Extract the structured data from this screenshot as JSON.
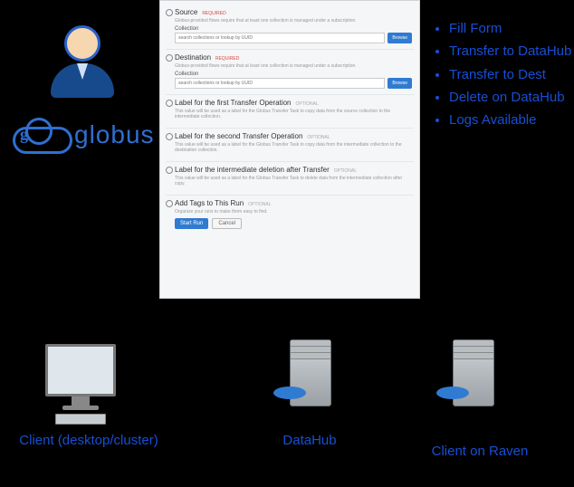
{
  "globus": {
    "logo_text": "globus",
    "logo_letter": "g"
  },
  "form": {
    "source": {
      "title": "Source",
      "required_tag": "REQUIRED",
      "desc": "Globus-provided flows require that at least one collection is managed under a subscription.",
      "collection_label": "Collection",
      "search_placeholder": "search collections or lookup by UUID",
      "browse": "Browse"
    },
    "destination": {
      "title": "Destination",
      "required_tag": "REQUIRED",
      "desc": "Globus-provided flows require that at least one collection is managed under a subscription.",
      "collection_label": "Collection",
      "search_placeholder": "search collections or lookup by UUID",
      "browse": "Browse"
    },
    "label1": {
      "title": "Label for the first Transfer Operation",
      "opt_tag": "OPTIONAL",
      "desc": "This value will be used as a label for the Globus Transfer Task to copy data from the source collection to the intermediate collection."
    },
    "label2": {
      "title": "Label for the second Transfer Operation",
      "opt_tag": "OPTIONAL",
      "desc": "This value will be used as a label for the Globus Transfer Task to copy data from the intermediate collection to the destination collection."
    },
    "label3": {
      "title": "Label for the intermediate deletion after Transfer",
      "opt_tag": "OPTIONAL",
      "desc": "This value will be used as a label for the Globus Transfer Task to delete data from the intermediate collection after copy."
    },
    "tags": {
      "title": "Add Tags to This Run",
      "opt_tag": "OPTIONAL",
      "desc": "Organize your runs to make them easy to find."
    },
    "run_btn": "Start Run",
    "cancel_btn": "Cancel"
  },
  "bullets": [
    "Fill Form",
    "Transfer to DataHub",
    "Transfer to Dest",
    "Delete on DataHub",
    "Logs Available"
  ],
  "nodes": {
    "client": "Client (desktop/cluster)",
    "datahub": "DataHub",
    "raven": "Client on Raven"
  }
}
